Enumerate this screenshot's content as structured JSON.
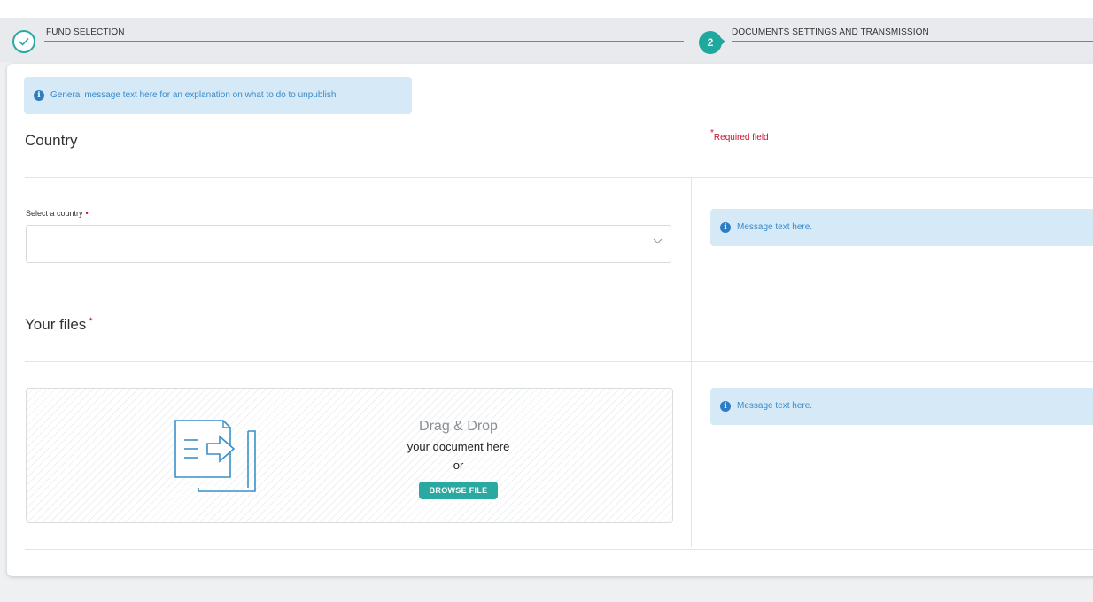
{
  "stepper": {
    "steps": [
      {
        "label": "FUND SELECTION",
        "state": "completed"
      },
      {
        "label": "DOCUMENTS SETTINGS AND TRANSMISSION",
        "number": "2",
        "state": "active"
      }
    ]
  },
  "messages": {
    "general": "General  message text here for an explanation on what to do to unpublish",
    "country_side": "Message text here.",
    "files_side": "Message text here."
  },
  "country_section": {
    "title": "Country",
    "required_note": "Required field",
    "required_marker": "*",
    "select_label": "Select a country",
    "select_value": ""
  },
  "files_section": {
    "title": "Your files",
    "required_marker": "*",
    "dropzone": {
      "title": "Drag & Drop",
      "subtitle": "your document here",
      "or": "or",
      "browse_label": "BROWSE FILE"
    }
  },
  "colors": {
    "accent": "#2aa9a0",
    "info_bg": "#d6e9f7",
    "info_text": "#3a8bc8",
    "required": "#c8102e"
  },
  "icons": {
    "step_complete": "check-icon",
    "info": "info-icon",
    "select": "chevron-down-icon",
    "dropzone": "document-upload-icon"
  }
}
